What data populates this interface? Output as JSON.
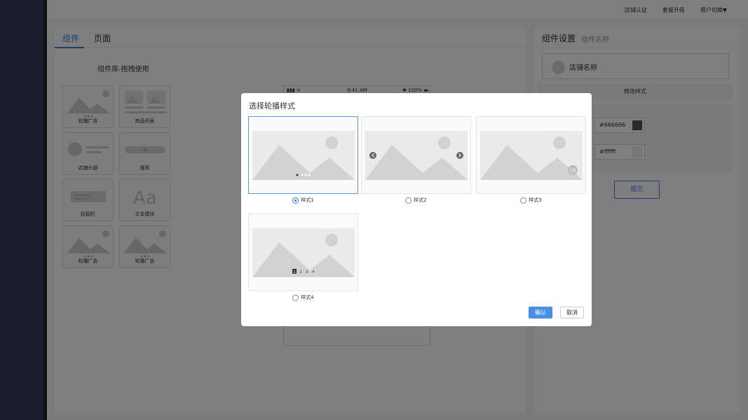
{
  "topbar": {
    "links": [
      "店铺认证",
      "套餐升级",
      "用户切换▼"
    ]
  },
  "main": {
    "tabs": [
      {
        "label": "组件"
      },
      {
        "label": "页面"
      }
    ],
    "library_title": "组件库-拖拽使用",
    "components": [
      {
        "label": "轮播广告",
        "icon": "banner-image-icon"
      },
      {
        "label": "商品列表",
        "icon": "product-list-icon"
      },
      {
        "label": "店铺头部",
        "icon": "shop-header-icon"
      },
      {
        "label": "搜索",
        "icon": "search-bar-icon"
      },
      {
        "label": "标题栏",
        "icon": "title-bar-icon"
      },
      {
        "label": "文本模块",
        "icon": "text-module-icon"
      },
      {
        "label": "轮播广告",
        "icon": "banner-image-icon"
      },
      {
        "label": "轮播广告",
        "icon": "banner-image-icon"
      }
    ]
  },
  "phone": {
    "signal": "▮▮▮ ᯤ",
    "time": "9:41 AM",
    "battery": "✱ 100% ▬"
  },
  "settings": {
    "title": "组件设置",
    "subtitle": "组件名称",
    "shop_name": "店铺名称",
    "modify_style": "修改样式",
    "colors": [
      {
        "value": "#666666",
        "swatch": "#555555"
      },
      {
        "value": "#ffffff",
        "swatch": "#f3f3f3"
      }
    ],
    "submit": "提交"
  },
  "modal": {
    "title": "选择轮播样式",
    "options": [
      {
        "label": "样式1",
        "selected": true
      },
      {
        "label": "样式2",
        "selected": false
      },
      {
        "label": "样式3",
        "selected": false
      },
      {
        "label": "样式4",
        "selected": false
      }
    ],
    "style3_counter": "1/5",
    "style4_pages": [
      "1",
      "2",
      "3",
      "4"
    ],
    "confirm": "确认",
    "cancel": "取消"
  },
  "colors": {
    "accent": "#3a7de0",
    "sidebar": "#363a54",
    "confirm_bg": "#4a90e2"
  }
}
